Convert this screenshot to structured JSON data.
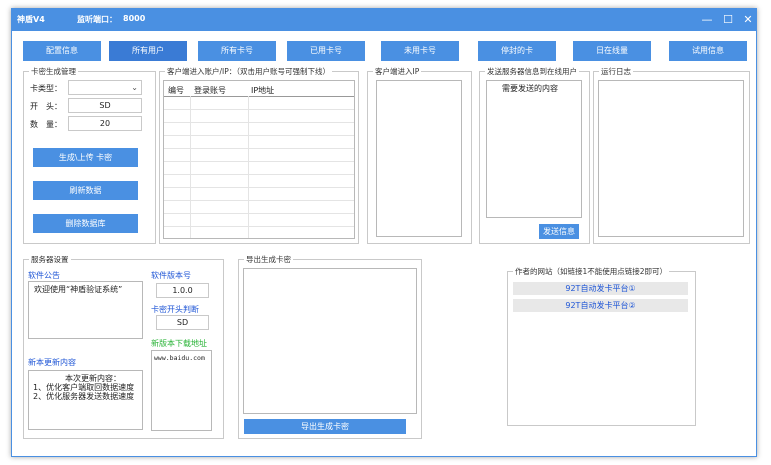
{
  "window": {
    "title": "神盾V4",
    "port_label": "监听端口：",
    "port_value": "8000",
    "minimize": "—",
    "maximize": "☐",
    "close": "✕"
  },
  "tabs": [
    {
      "label": "配置信息"
    },
    {
      "label": "所有用户"
    },
    {
      "label": "所有卡号"
    },
    {
      "label": "已用卡号"
    },
    {
      "label": "未用卡号"
    },
    {
      "label": "停封的卡"
    },
    {
      "label": "日在线量"
    },
    {
      "label": "试用信息"
    }
  ],
  "card_gen": {
    "title": "卡密生成管理",
    "type_label": "卡类型：",
    "type_value": "",
    "prefix_label": "开　头：",
    "prefix_value": "SD",
    "count_label": "数　量：",
    "count_value": "20",
    "gen_button": "生成\\上传 卡密",
    "refresh_button": "刷新数据",
    "delete_button": "删除数据库"
  },
  "accounts": {
    "title": "客户端进入账户/IP：（双击用户账号可强制下线）",
    "col_id": "编号",
    "col_account": "登录账号",
    "col_ip": "IP地址"
  },
  "client_ip": {
    "title": "客户端进入IP"
  },
  "send_msg": {
    "title": "发送服务器信息到在线用户",
    "content": "需要发送的内容",
    "send_button": "发送信息"
  },
  "log": {
    "title": "运行日志"
  },
  "server": {
    "title": "服务器设置",
    "notice_label": "软件公告",
    "notice_text": "欢迎使用“神盾验证系统”",
    "version_label": "软件版本号",
    "version_value": "1.0.0",
    "card_prefix_label": "卡密开头判断",
    "card_prefix_value": "SD",
    "download_label": "新版本下载地址",
    "download_value": "www.baidu.com",
    "update_label": "新本更新内容",
    "update_text": "　　　　本次更新内容：\n1、优化客户端取回数据速度\n2、优化服务器发送数据速度"
  },
  "export": {
    "title": "导出生成卡密",
    "button": "导出生成卡密"
  },
  "author": {
    "title": "作者的网站（如链接1不能使用点链接2即可）",
    "link1": "92T自动发卡平台①",
    "link2": "92T自动发卡平台②"
  }
}
